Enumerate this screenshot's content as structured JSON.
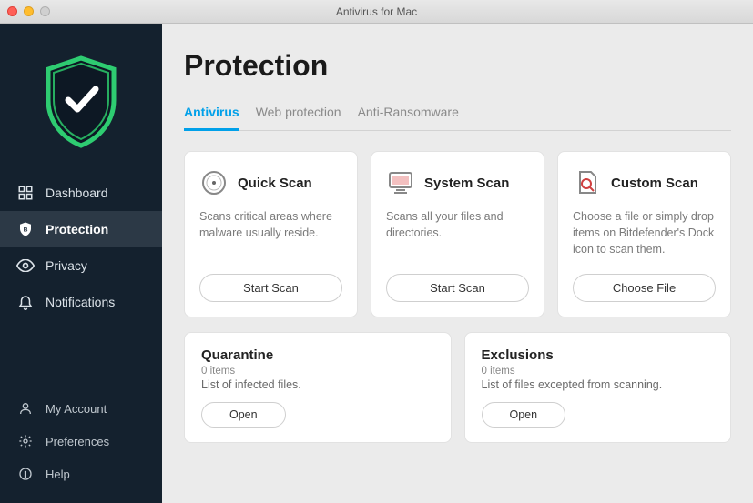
{
  "window": {
    "title": "Antivirus for Mac"
  },
  "sidebar": {
    "items": [
      {
        "label": "Dashboard"
      },
      {
        "label": "Protection"
      },
      {
        "label": "Privacy"
      },
      {
        "label": "Notifications"
      }
    ],
    "bottom": [
      {
        "label": "My Account"
      },
      {
        "label": "Preferences"
      },
      {
        "label": "Help"
      }
    ]
  },
  "page": {
    "title": "Protection"
  },
  "tabs": [
    {
      "label": "Antivirus"
    },
    {
      "label": "Web protection"
    },
    {
      "label": "Anti-Ransomware"
    }
  ],
  "scan_cards": [
    {
      "title": "Quick Scan",
      "desc": "Scans critical areas where malware usually reside.",
      "button": "Start Scan"
    },
    {
      "title": "System Scan",
      "desc": "Scans all your files and directories.",
      "button": "Start Scan"
    },
    {
      "title": "Custom Scan",
      "desc": "Choose a file or simply drop items on Bitdefender's Dock icon to scan them.",
      "button": "Choose File"
    }
  ],
  "bottom_cards": [
    {
      "title": "Quarantine",
      "sub": "0 items",
      "desc": "List of infected files.",
      "button": "Open"
    },
    {
      "title": "Exclusions",
      "sub": "0 items",
      "desc": "List of files excepted from scanning.",
      "button": "Open"
    }
  ]
}
